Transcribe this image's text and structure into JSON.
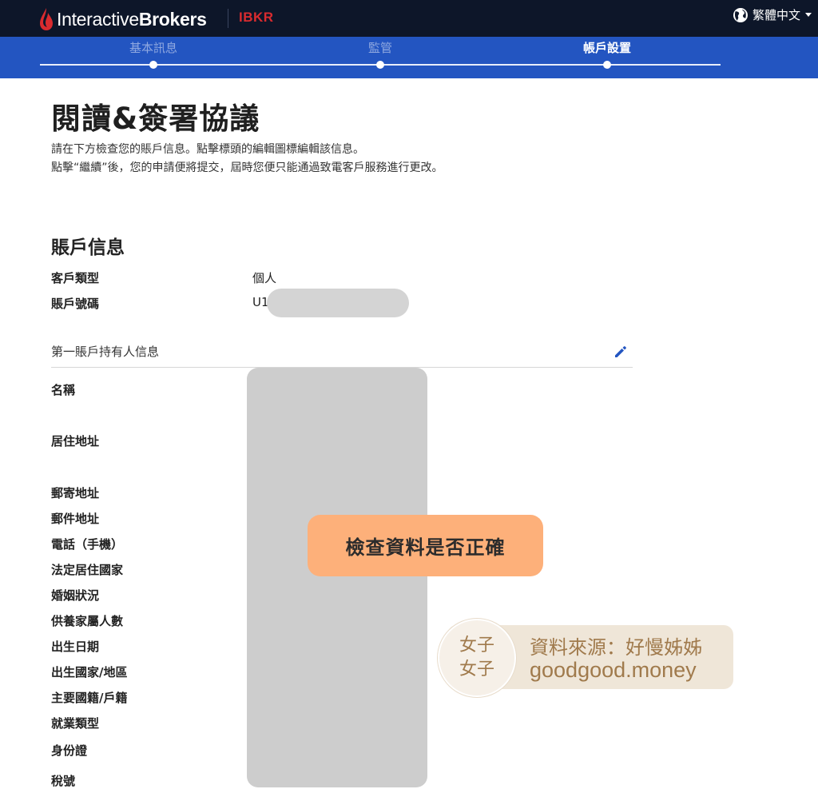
{
  "header": {
    "brand_light": "Interactive",
    "brand_bold": "Brokers",
    "ticker": "IBKR",
    "language": "繁體中文"
  },
  "stepper": {
    "steps": [
      {
        "label": "基本訊息",
        "state": "done"
      },
      {
        "label": "監管",
        "state": "done"
      },
      {
        "label": "帳戶設置",
        "state": "active"
      }
    ]
  },
  "page": {
    "title": "閱讀&簽署協議",
    "intro_line1": "請在下方檢查您的賬戶信息。點擊標頭的編輯圖標編輯該信息。",
    "intro_line2": "點擊“繼續”後，您的申請便將提交，屆時您便只能通過致電客戶服務進行更改。"
  },
  "account_info": {
    "title": "賬戶信息",
    "rows": [
      {
        "label": "客戶類型",
        "value": "個人"
      },
      {
        "label": "賬戶號碼",
        "value": "U1"
      }
    ]
  },
  "holder_section": {
    "title": "第一賬戶持有人信息",
    "fields": [
      "名稱",
      "居住地址",
      "郵寄地址",
      "郵件地址",
      "電話（手機）",
      "法定居住國家",
      "婚姻狀況",
      "供養家屬人數",
      "出生日期",
      "出生國家/地區",
      "主要國籍/戶籍",
      "就業類型",
      "身份證",
      "稅號"
    ]
  },
  "overlay": {
    "callout": "檢查資料是否正確",
    "credit_badge_top": "女子",
    "credit_badge_bottom": "女子",
    "credit_line1": "資料來源：好慢姊姊",
    "credit_line2": "goodgood.money"
  },
  "colors": {
    "topbar": "#0d1629",
    "stepper": "#2355c1",
    "ticker": "#d92b2f",
    "edit_icon": "#2355c1",
    "callout": "#fdb07a",
    "credit_text": "#a07a4c"
  }
}
